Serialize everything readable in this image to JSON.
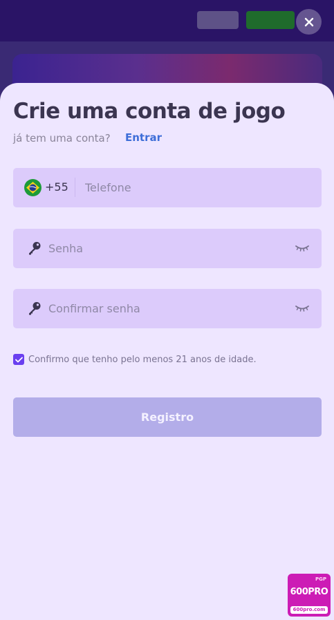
{
  "modal": {
    "title": "Crie uma conta de jogo",
    "subtitle": "já tem uma conta?",
    "login_link": "Entrar"
  },
  "phone": {
    "country_flag": "brazil-flag-icon",
    "dial_code": "+55",
    "placeholder": "Telefone"
  },
  "password": {
    "placeholder": "Senha",
    "icon": "key-icon",
    "toggle_icon": "eye-closed-icon"
  },
  "confirm_password": {
    "placeholder": "Confirmar senha",
    "icon": "key-icon",
    "toggle_icon": "eye-closed-icon"
  },
  "age_confirmation": {
    "checked": true,
    "label": "Confirmo que tenho pelo menos 21 anos de idade."
  },
  "submit": {
    "label": "Registro"
  },
  "watermark": {
    "top": "PGP",
    "main": "600PRO",
    "site": "600pro.com"
  },
  "colors": {
    "accent": "#6a3ff0",
    "link": "#3e6ed8",
    "modal_bg": "#eee6ff",
    "field_bg": "#dccbfb",
    "button_disabled": "#b3ade9"
  }
}
